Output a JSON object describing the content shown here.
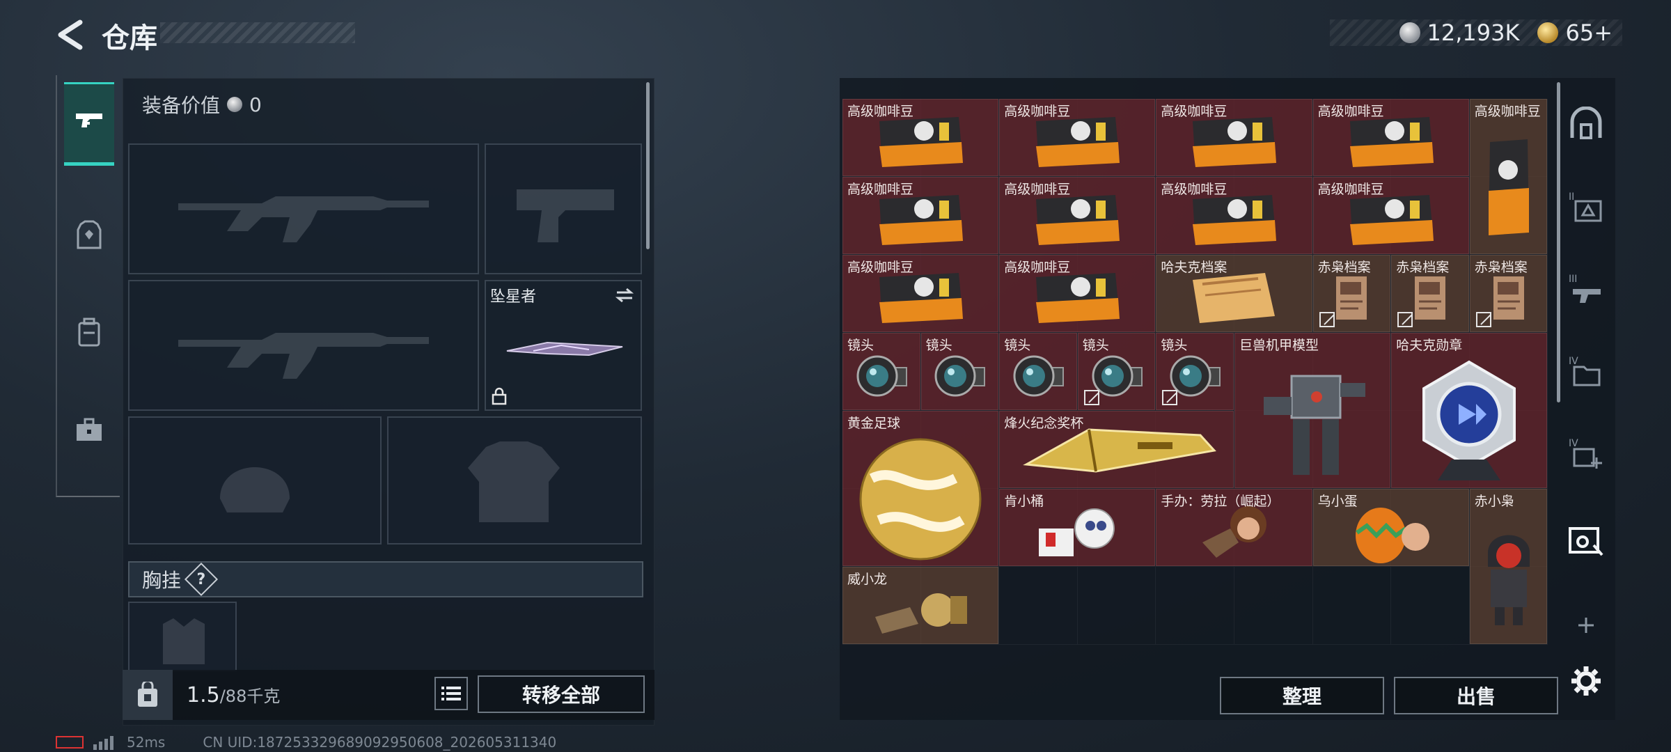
{
  "header": {
    "title": "仓库",
    "currency_silver": "12,193K",
    "currency_gold": "65+"
  },
  "equipment": {
    "value_label": "装备价值",
    "value": "0",
    "melee_name": "坠星者",
    "chest_label": "胸挂",
    "help": "?"
  },
  "bottom_left": {
    "weight_current": "1.5",
    "weight_max": "/88千克",
    "transfer_all": "转移全部"
  },
  "storage": {
    "items": [
      {
        "name": "高级咖啡豆",
        "art": "coffee"
      },
      {
        "name": "高级咖啡豆",
        "art": "coffee"
      },
      {
        "name": "高级咖啡豆",
        "art": "coffee"
      },
      {
        "name": "高级咖啡豆",
        "art": "coffee"
      },
      {
        "name": "高级咖啡豆",
        "art": "coffee-tall"
      },
      {
        "name": "高级咖啡豆",
        "art": "coffee"
      },
      {
        "name": "高级咖啡豆",
        "art": "coffee"
      },
      {
        "name": "高级咖啡豆",
        "art": "coffee"
      },
      {
        "name": "高级咖啡豆",
        "art": "coffee"
      },
      {
        "name": "高级咖啡豆",
        "art": "coffee"
      },
      {
        "name": "高级咖啡豆",
        "art": "coffee"
      },
      {
        "name": "哈夫克档案",
        "art": "file"
      },
      {
        "name": "赤枭档案",
        "art": "note"
      },
      {
        "name": "赤枭档案",
        "art": "note"
      },
      {
        "name": "赤枭档案",
        "art": "note"
      },
      {
        "name": "镜头",
        "art": "lens"
      },
      {
        "name": "镜头",
        "art": "lens"
      },
      {
        "name": "镜头",
        "art": "lens"
      },
      {
        "name": "镜头",
        "art": "lens"
      },
      {
        "name": "镜头",
        "art": "lens"
      },
      {
        "name": "巨兽机甲模型",
        "art": "mech"
      },
      {
        "name": "哈夫克勋章",
        "art": "medal"
      },
      {
        "name": "黄金足球",
        "art": "ball"
      },
      {
        "name": "烽火纪念奖杯",
        "art": "trophy"
      },
      {
        "name": "肯小桶",
        "art": "figure-white"
      },
      {
        "name": "手办：劳拉（崛起）",
        "art": "figure-brown"
      },
      {
        "name": "乌小蛋",
        "art": "figure-egg"
      },
      {
        "name": "赤小枭",
        "art": "figure-red"
      },
      {
        "name": "威小龙",
        "art": "figure-gold"
      }
    ],
    "sort_label": "整理",
    "sell_label": "出售"
  },
  "status": {
    "ping": "52ms",
    "uid": "CN UID:187253329689092950608_202605311340"
  },
  "colors": {
    "accent": "#36d3c2",
    "item_red": "#68262c",
    "item_brown": "#5c4032"
  }
}
